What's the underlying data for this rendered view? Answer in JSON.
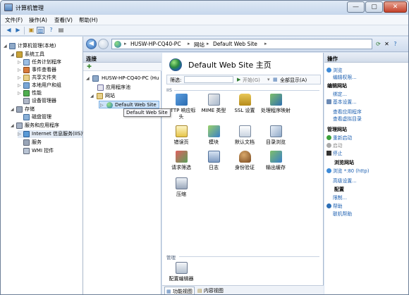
{
  "window": {
    "title": "计算机管理"
  },
  "menubar": {
    "items": [
      "文件(F)",
      "操作(A)",
      "查看(V)",
      "帮助(H)"
    ]
  },
  "tree": {
    "items": [
      {
        "label": "计算机管理(本地)"
      },
      {
        "label": "系统工具"
      },
      {
        "label": "任务计划程序"
      },
      {
        "label": "事件查看器"
      },
      {
        "label": "共享文件夹"
      },
      {
        "label": "本地用户和组"
      },
      {
        "label": "性能"
      },
      {
        "label": "设备管理器"
      },
      {
        "label": "存储"
      },
      {
        "label": "磁盘管理"
      },
      {
        "label": "服务和应用程序"
      },
      {
        "label": "Internet 信息服务(IIS)管"
      },
      {
        "label": "服务"
      },
      {
        "label": "WMI 控件"
      }
    ]
  },
  "address": {
    "crumbs": [
      "HUSW-HP-CQ40-PC",
      "网站",
      "Default Web Site"
    ]
  },
  "connections": {
    "header": "连接",
    "items": [
      {
        "label": "HUSW-HP-CQ40-PC (Hu"
      },
      {
        "label": "应用程序池"
      },
      {
        "label": "网站"
      },
      {
        "label": "Default Web Site"
      }
    ]
  },
  "tooltip": "Default Web Site",
  "main": {
    "title": "Default Web Site 主页",
    "filter": {
      "label": "筛选:",
      "go": "开始(G)",
      "show_all": "全部显示(A)"
    },
    "section_iis": "IIS",
    "section_mgmt": "管理",
    "features": [
      {
        "label": "HTTP 响应标头",
        "icon": "http-headers-icon"
      },
      {
        "label": "MIME 类型",
        "icon": "mime-icon"
      },
      {
        "label": "SSL 设置",
        "icon": "lock-icon"
      },
      {
        "label": "处理程序映射",
        "icon": "handler-icon"
      },
      {
        "label": "错误页",
        "icon": "error-page-icon"
      },
      {
        "label": "模块",
        "icon": "modules-icon"
      },
      {
        "label": "默认文档",
        "icon": "default-doc-icon"
      },
      {
        "label": "目录浏览",
        "icon": "dir-browse-icon"
      },
      {
        "label": "请求筛选",
        "icon": "request-filter-icon"
      },
      {
        "label": "日志",
        "icon": "log-icon"
      },
      {
        "label": "身份验证",
        "icon": "auth-icon"
      },
      {
        "label": "输出缓存",
        "icon": "output-cache-icon"
      },
      {
        "label": "压缩",
        "icon": "compression-icon"
      }
    ],
    "mgmt_features": [
      {
        "label": "配置编辑器",
        "icon": "config-editor-icon"
      }
    ],
    "tabs": [
      "功能视图",
      "内容视图"
    ]
  },
  "actions": {
    "header": "操作",
    "browse": "浏览",
    "edit_perm": "编辑权限...",
    "edit_site_h": "编辑网站",
    "bindings": "绑定...",
    "basic": "基本设置...",
    "view_apps": "查看应用程序",
    "view_vdirs": "查看虚拟目录",
    "manage_site_h": "管理网站",
    "restart": "重新启动",
    "start": "启动",
    "stop": "停止",
    "browse_site_h": "浏览网站",
    "browse_80": "浏览 *:80 (http)",
    "advanced": "高级设置...",
    "config_h": "配置",
    "limits": "限制...",
    "help": "帮助",
    "online_help": "联机帮助"
  },
  "colors": {
    "link": "#1c5fb0",
    "pane_bg": "#dbe6f4",
    "title_bg": "#c6d7ec"
  }
}
